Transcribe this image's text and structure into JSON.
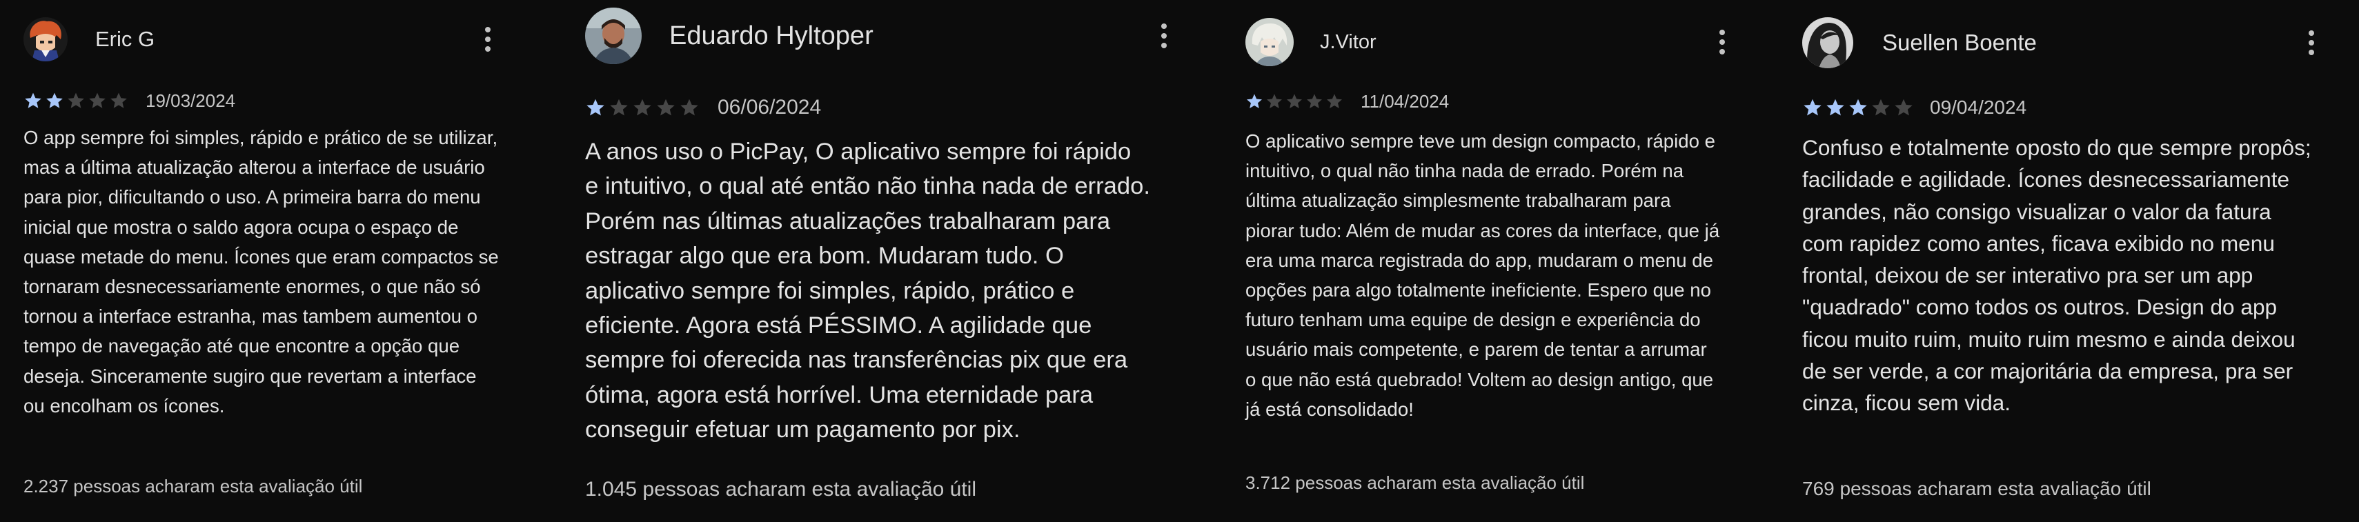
{
  "reviews": [
    {
      "author": "Eric G",
      "avatar_icon": "cartoon-avatar-icon",
      "rating": 2,
      "date": "19/03/2024",
      "text": "O app sempre foi simples, rápido e prático de se utilizar, mas a última atualização alterou a interface de usuário para pior, dificultando o uso. A primeira barra do menu inicial que mostra o saldo agora ocupa o espaço de quase metade do menu. Ícones que eram compactos se tornaram desnecessariamente enormes, o que não só tornou a interface estranha, mas tambem aumentou o tempo de navegação até que encontre a opção que deseja. Sinceramente sugiro que revertam a interface ou encolham os ícones.",
      "helpful": "2.237 pessoas acharam esta avaliação útil"
    },
    {
      "author": "Eduardo Hyltoper",
      "avatar_icon": "photo-avatar-icon",
      "rating": 1,
      "date": "06/06/2024",
      "text": "A anos uso o PicPay, O aplicativo sempre foi rápido e intuitivo, o qual até então não tinha nada de errado. Porém nas últimas atualizações trabalharam para estragar algo que era bom. Mudaram tudo. O aplicativo sempre foi simples, rápido, prático e eficiente. Agora está PÉSSIMO. A agilidade que sempre foi oferecida nas transferências pix que era ótima, agora está horrível. Uma eternidade para conseguir efetuar um pagamento por pix.",
      "helpful": "1.045 pessoas acharam esta avaliação útil"
    },
    {
      "author": "J.Vitor",
      "avatar_icon": "anime-avatar-icon",
      "rating": 1,
      "date": "11/04/2024",
      "text": "O aplicativo sempre teve um design compacto, rápido e intuitivo, o qual não tinha nada de errado. Porém na última atualização simplesmente trabalharam para piorar tudo: Além de mudar as cores da interface, que já era uma marca registrada do app, mudaram o menu de opções para algo totalmente ineficiente. Espero que no futuro tenham uma equipe de design e experiência do usuário mais competente, e parem de tentar a arrumar o que não está quebrado! Voltem ao design antigo, que já está consolidado!",
      "helpful": "3.712 pessoas acharam esta avaliação útil"
    },
    {
      "author": "Suellen Boente",
      "avatar_icon": "portrait-avatar-icon",
      "rating": 3,
      "date": "09/04/2024",
      "text": "Confuso e totalmente oposto do que sempre propôs; facilidade e agilidade. Ícones desnecessariamente grandes, não consigo visualizar o valor da fatura com rapidez como antes, ficava exibido no menu frontal, deixou de ser interativo pra ser um app \"quadrado\" como todos os outros. Design do app ficou muito ruim, muito ruim mesmo e ainda deixou de ser verde, a cor majoritária da empresa, pra ser cinza, ficou sem vida.",
      "helpful": "769 pessoas acharam esta avaliação útil"
    }
  ],
  "colors": {
    "star_filled": "#a8c7fa",
    "star_empty": "#474747",
    "background": "#0c0c0c",
    "text": "#e3e3e3",
    "muted": "#c6c6c6"
  },
  "icons": {
    "menu": "more-vert-icon",
    "star": "star-icon"
  }
}
